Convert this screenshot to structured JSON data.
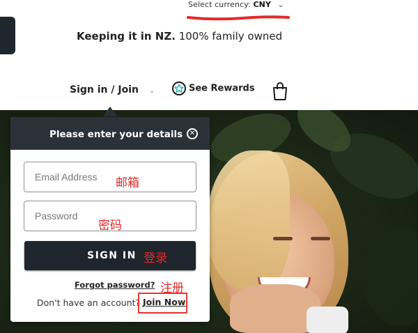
{
  "header": {
    "currency_label": "Select currency:",
    "currency_code": "CNY",
    "tagline_bold": "Keeping it in NZ.",
    "tagline_rest": " 100% family owned"
  },
  "nav": {
    "signin_label": "Sign in / Join",
    "rewards_label": "See Rewards",
    "icons": [
      "chevron-down-icon",
      "star-circle-icon",
      "shopping-bag-icon"
    ]
  },
  "login_panel": {
    "title": "Please enter your details",
    "email_placeholder": "Email Address",
    "password_placeholder": "Password",
    "signin_button": "SIGN IN",
    "forgot_password": "Forgot password?",
    "no_account_text": "Don't have an account?",
    "join_now": "Join Now"
  },
  "annotations": {
    "email": "邮箱",
    "password": "密码",
    "signin": "登录",
    "register": "注册"
  },
  "colors": {
    "panel_header": "#2b3138",
    "button": "#1f252c",
    "annotation_red": "#e32a2a",
    "rewards_star": "#22b3a6"
  }
}
